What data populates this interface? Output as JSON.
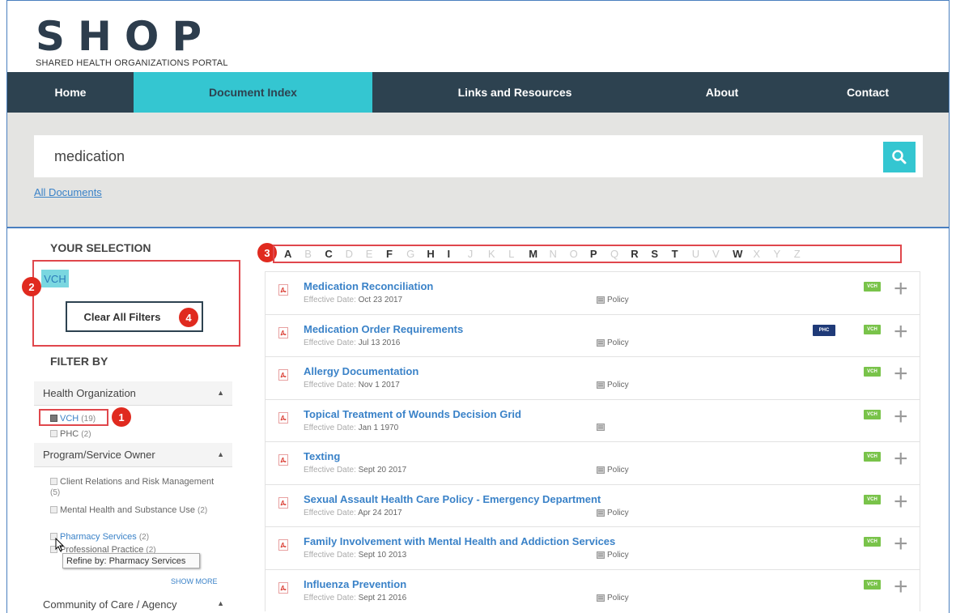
{
  "window_title": "Shared Health Organizations Portal",
  "logo": {
    "main": "SHOP",
    "sub": "SHARED HEALTH ORGANIZATIONS PORTAL"
  },
  "nav": [
    {
      "label": "Home"
    },
    {
      "label": "Document Index",
      "active": true
    },
    {
      "label": "Links and Resources"
    },
    {
      "label": "About"
    },
    {
      "label": "Contact"
    }
  ],
  "search": {
    "value": "medication",
    "icon": "search-icon"
  },
  "all_documents_link": "All Documents",
  "selection": {
    "heading": "YOUR SELECTION",
    "chip": "VCH",
    "clear_label": "Clear All Filters"
  },
  "filter": {
    "heading": "FILTER BY",
    "health_org": {
      "label": "Health Organization",
      "items": [
        {
          "name": "VCH",
          "count": "(19)",
          "checked": true
        },
        {
          "name": "PHC",
          "count": "(2)",
          "checked": false
        }
      ]
    },
    "program": {
      "label": "Program/Service Owner",
      "items": [
        {
          "name": "Client Relations and Risk Management",
          "count": "(5)"
        },
        {
          "name": "Mental Health and Substance Use",
          "count": "(2)"
        },
        {
          "name": "Pharmacy Services",
          "count": "(2)"
        },
        {
          "name": "Professional Practice",
          "count": "(2)"
        }
      ]
    },
    "tooltip": "Refine by: Pharmacy Services",
    "show_more": "SHOW MORE",
    "community": {
      "label": "Community of Care / Agency"
    }
  },
  "badges": {
    "b1": "1",
    "b2": "2",
    "b3": "3",
    "b4": "4"
  },
  "alphabet": [
    {
      "l": "A",
      "on": true
    },
    {
      "l": "B",
      "on": false
    },
    {
      "l": "C",
      "on": true
    },
    {
      "l": "D",
      "on": false
    },
    {
      "l": "E",
      "on": false
    },
    {
      "l": "F",
      "on": true
    },
    {
      "l": "G",
      "on": false
    },
    {
      "l": "H",
      "on": true
    },
    {
      "l": "I",
      "on": true
    },
    {
      "l": "J",
      "on": false
    },
    {
      "l": "K",
      "on": false
    },
    {
      "l": "L",
      "on": false
    },
    {
      "l": "M",
      "on": true
    },
    {
      "l": "N",
      "on": false
    },
    {
      "l": "O",
      "on": false
    },
    {
      "l": "P",
      "on": true
    },
    {
      "l": "Q",
      "on": false
    },
    {
      "l": "R",
      "on": true
    },
    {
      "l": "S",
      "on": true
    },
    {
      "l": "T",
      "on": true
    },
    {
      "l": "U",
      "on": false
    },
    {
      "l": "V",
      "on": false
    },
    {
      "l": "W",
      "on": true
    },
    {
      "l": "X",
      "on": false
    },
    {
      "l": "Y",
      "on": false
    },
    {
      "l": "Z",
      "on": false
    }
  ],
  "effective_label": "Effective Date:",
  "results": [
    {
      "title": "Medication Reconciliation",
      "date": "Oct 23 2017",
      "type": "Policy",
      "phc": false
    },
    {
      "title": "Medication Order Requirements",
      "date": "Jul 13 2016",
      "type": "Policy",
      "phc": true
    },
    {
      "title": "Allergy Documentation",
      "date": "Nov 1 2017",
      "type": "Policy",
      "phc": false
    },
    {
      "title": "Topical Treatment of Wounds Decision Grid",
      "date": "Jan 1 1970",
      "type": "",
      "phc": false
    },
    {
      "title": "Texting",
      "date": "Sept 20 2017",
      "type": "Policy",
      "phc": false
    },
    {
      "title": "Sexual Assault Health Care Policy - Emergency Department",
      "date": "Apr 24 2017",
      "type": "Policy",
      "phc": false
    },
    {
      "title": "Family Involvement with Mental Health and Addiction Services",
      "date": "Sept 10 2013",
      "type": "Policy",
      "phc": false
    },
    {
      "title": "Influenza Prevention",
      "date": "Sept 21 2016",
      "type": "Policy",
      "phc": false
    }
  ],
  "tags": {
    "vch": "VCH",
    "phc": "PHC"
  },
  "colors": {
    "nav_bg": "#2d4250",
    "accent": "#34c6d1",
    "link": "#3a82c8",
    "badge": "#e02a1f",
    "vch_tag": "#79c34a",
    "phc_tag": "#1f3a78"
  }
}
